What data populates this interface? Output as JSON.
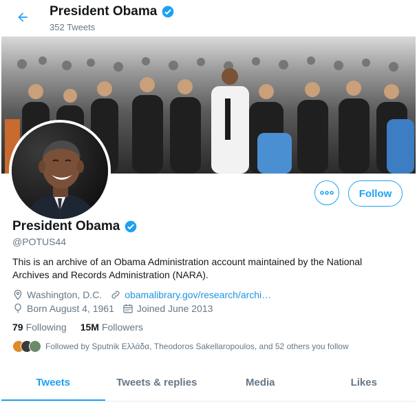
{
  "header": {
    "title": "President Obama",
    "tweet_count": "352 Tweets"
  },
  "profile": {
    "name": "President Obama",
    "handle": "@POTUS44",
    "bio": "This is an archive of an Obama Administration account maintained by the National Archives and Records Administration (NARA).",
    "location": "Washington, D.C.",
    "website": "obamalibrary.gov/research/archi…",
    "birthday": "Born August 4, 1961",
    "joined": "Joined June 2013",
    "following_count": "79",
    "following_label": "Following",
    "followers_count": "15M",
    "followers_label": "Followers",
    "followed_by": "Followed by Sputnik Ελλάδα, Theodoros Sakellaropoulos, and 52 others you follow"
  },
  "actions": {
    "follow_label": "Follow",
    "more_icon": "more-icon"
  },
  "tabs": [
    {
      "label": "Tweets",
      "active": true
    },
    {
      "label": "Tweets & replies",
      "active": false
    },
    {
      "label": "Media",
      "active": false
    },
    {
      "label": "Likes",
      "active": false
    }
  ],
  "colors": {
    "accent": "#1da1f2",
    "link": "#1b95e0",
    "muted": "#657786",
    "text": "#14171a"
  }
}
